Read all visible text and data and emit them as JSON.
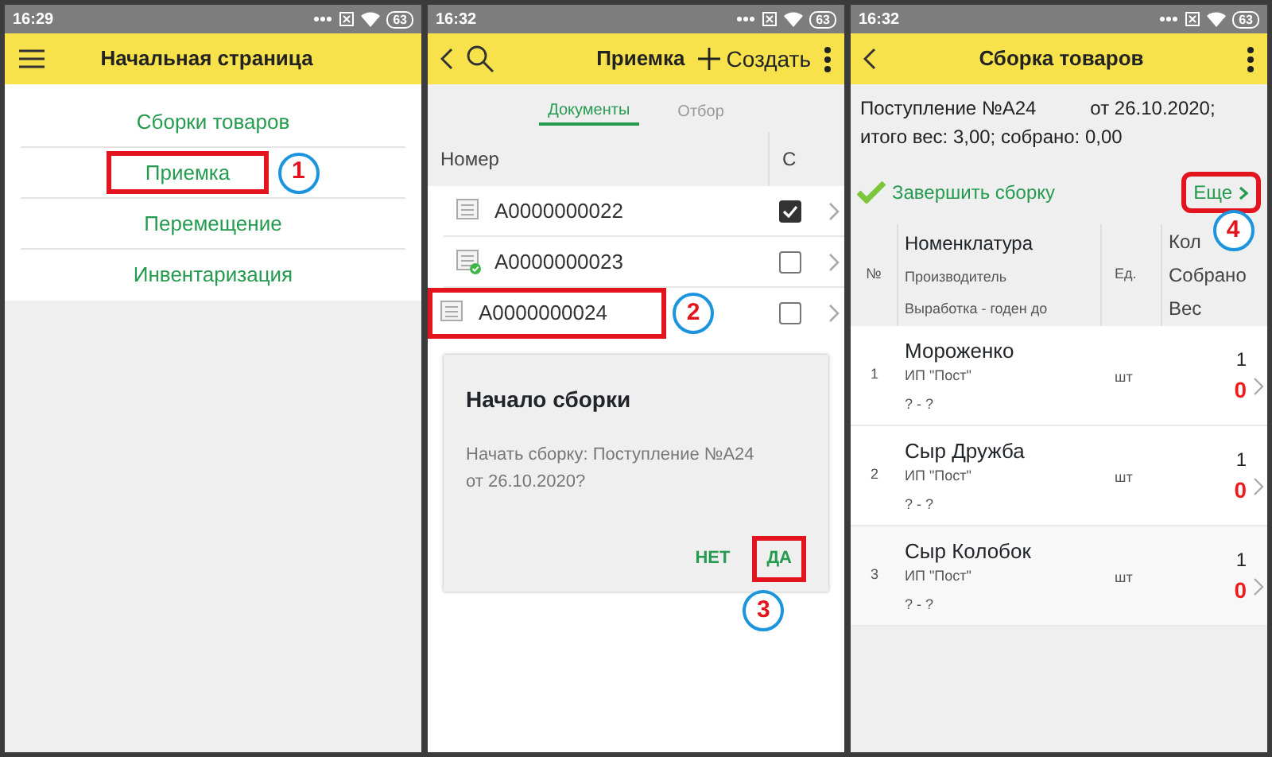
{
  "screens": [
    {
      "kind": "home",
      "status_bar": {
        "time": "16:29",
        "battery": "63"
      },
      "title": "Начальная страница",
      "menu": [
        {
          "label": "Сборки товаров",
          "highlighted": false
        },
        {
          "label": "Приемка",
          "highlighted": true,
          "callout": "1"
        },
        {
          "label": "Перемещение",
          "highlighted": false
        },
        {
          "label": "Инвентаризация",
          "highlighted": false
        }
      ]
    },
    {
      "kind": "list",
      "status_bar": {
        "time": "16:32",
        "battery": "63"
      },
      "title": "Приемка",
      "create_label": "Создать",
      "tabs": [
        {
          "label": "Документы",
          "selected": true
        },
        {
          "label": "Отбор",
          "selected": false
        }
      ],
      "columns": [
        "Номер",
        "С"
      ],
      "rows": [
        {
          "number": "A0000000022",
          "posted": false,
          "checked": true,
          "highlighted": false
        },
        {
          "number": "A0000000023",
          "posted": true,
          "checked": false,
          "highlighted": false
        },
        {
          "number": "A0000000024",
          "posted": false,
          "checked": false,
          "highlighted": true,
          "callout": "2"
        }
      ],
      "dialog": {
        "title": "Начало сборки",
        "message": "Начать сборку: Поступление №А24 от 26.10.2020?",
        "buttons": [
          {
            "label": "НЕТ",
            "highlighted": false
          },
          {
            "label": "ДА",
            "highlighted": true,
            "callout": "3"
          }
        ]
      }
    },
    {
      "kind": "assembly",
      "status_bar": {
        "time": "16:32",
        "battery": "63"
      },
      "title": "Сборка товаров",
      "document": "Поступление №А24",
      "date": "от 26.10.2020;",
      "totals": "итого вес: 3,00; собрано: 0,00",
      "finish_label": "Завершить сборку",
      "more": {
        "label": "Еще",
        "highlighted": true,
        "callout": "4"
      },
      "columns": {
        "no": "№",
        "name": [
          "Номенклатура",
          "Производитель",
          "Выработка - годен до"
        ],
        "unit": "Ед.",
        "qty": [
          "Кол",
          "Собрано",
          "Вес"
        ]
      },
      "rows": [
        {
          "no": "1",
          "name": "Мороженко",
          "producer": "ИП \"Пост\"",
          "dates": "? - ?",
          "unit": "шт",
          "quantity": "1",
          "collected": "0"
        },
        {
          "no": "2",
          "name": "Сыр Дружба",
          "producer": "ИП \"Пост\"",
          "dates": "? - ?",
          "unit": "шт",
          "quantity": "1",
          "collected": "0"
        },
        {
          "no": "3",
          "name": "Сыр Колобок",
          "producer": "ИП \"Пост\"",
          "dates": "? - ?",
          "unit": "шт",
          "quantity": "1",
          "collected": "0"
        }
      ]
    }
  ]
}
